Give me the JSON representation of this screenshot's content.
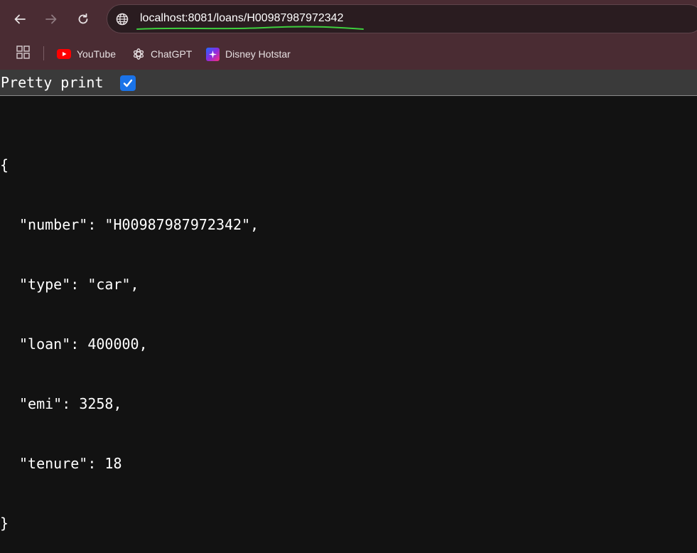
{
  "browser": {
    "url_host": "localhost",
    "url_rest": ":8081/loans/H00987987972342",
    "bookmarks": [
      {
        "label": "YouTube",
        "icon": "youtube-icon"
      },
      {
        "label": "ChatGPT",
        "icon": "chatgpt-icon"
      },
      {
        "label": "Disney Hotstar",
        "icon": "hotstar-icon"
      }
    ]
  },
  "viewer": {
    "pretty_print_label": "Pretty print",
    "pretty_print_checked": true
  },
  "json_lines": {
    "open": "{",
    "number_key": "\"number\"",
    "number_val": "\"H00987987972342\",",
    "type_key": "\"type\"",
    "type_val": "\"car\",",
    "loan_key": "\"loan\"",
    "loan_val": "400000,",
    "emi_key": "\"emi\"",
    "emi_val": "3258,",
    "tenure_key": "\"tenure\"",
    "tenure_val": "18",
    "close": "}"
  },
  "colors": {
    "chrome_bg": "#4a2c33",
    "page_bg": "#121212",
    "checkbox": "#1a73e8",
    "url_underline": "#3ecf3e"
  }
}
